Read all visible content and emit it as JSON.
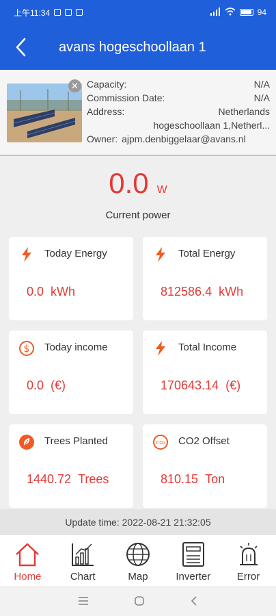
{
  "status": {
    "time": "上午11:34",
    "battery": "94"
  },
  "header": {
    "title": "avans hogeschoollaan 1"
  },
  "plant": {
    "capacity_label": "Capacity:",
    "capacity_value": "N/A",
    "commission_label": "Commission Date:",
    "commission_value": "N/A",
    "address_label": "Address:",
    "address_value": "Netherlands",
    "address_line2": "hogeschoollaan 1,Netherl...",
    "owner_label": "Owner:",
    "owner_value": "ajpm.denbiggelaar@avans.nl"
  },
  "power": {
    "value": "0.0",
    "unit": "W",
    "label": "Current power"
  },
  "cards": [
    {
      "label": "Today Energy",
      "value": "0.0",
      "unit": "kWh",
      "icon": "lightning-icon"
    },
    {
      "label": "Total Energy",
      "value": "812586.4",
      "unit": "kWh",
      "icon": "lightning-icon"
    },
    {
      "label": "Today income",
      "value": "0.0",
      "unit": "(€)",
      "icon": "dollar-icon"
    },
    {
      "label": "Total Income",
      "value": "170643.14",
      "unit": "(€)",
      "icon": "lightning-icon"
    },
    {
      "label": "Trees Planted",
      "value": "1440.72",
      "unit": "Trees",
      "icon": "leaf-icon"
    },
    {
      "label": "CO2 Offset",
      "value": "810.15",
      "unit": "Ton",
      "icon": "co2-icon"
    }
  ],
  "update": {
    "text": "Update time: 2022-08-21 21:32:05"
  },
  "tabs": [
    {
      "label": "Home",
      "icon": "home-icon"
    },
    {
      "label": "Chart",
      "icon": "chart-icon"
    },
    {
      "label": "Map",
      "icon": "globe-icon"
    },
    {
      "label": "Inverter",
      "icon": "inverter-icon"
    },
    {
      "label": "Error",
      "icon": "alarm-icon"
    }
  ],
  "colors": {
    "brand": "#1f5fd9",
    "accent": "#e53935"
  }
}
